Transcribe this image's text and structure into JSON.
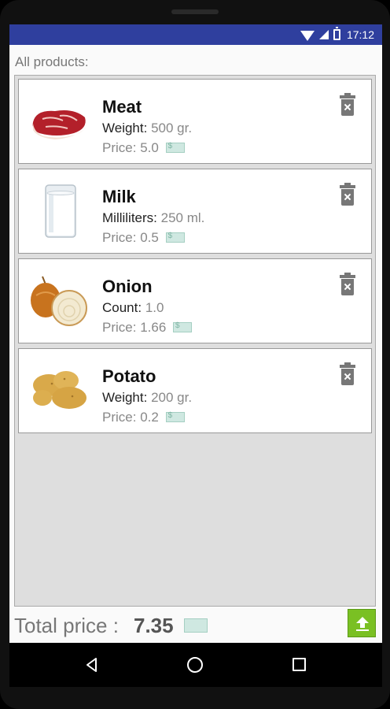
{
  "status": {
    "time": "17:12"
  },
  "header": {
    "label": "All products:"
  },
  "products": [
    {
      "name": "Meat",
      "attr_label": "Weight:",
      "attr_value": "500 gr.",
      "price_label": "Price:",
      "price_value": "5.0",
      "icon": "meat-icon"
    },
    {
      "name": "Milk",
      "attr_label": "Milliliters:",
      "attr_value": "250 ml.",
      "price_label": "Price:",
      "price_value": "0.5",
      "icon": "milk-icon"
    },
    {
      "name": "Onion",
      "attr_label": "Count:",
      "attr_value": "1.0",
      "price_label": "Price:",
      "price_value": "1.66",
      "icon": "onion-icon"
    },
    {
      "name": "Potato",
      "attr_label": "Weight:",
      "attr_value": "200 gr.",
      "price_label": "Price:",
      "price_value": "0.2",
      "icon": "potato-icon"
    }
  ],
  "footer": {
    "total_label": "Total price :",
    "total_value": "7.35"
  },
  "colors": {
    "status_bar": "#2f3f9e",
    "upload_button": "#7ac023",
    "list_background": "#dedede"
  }
}
